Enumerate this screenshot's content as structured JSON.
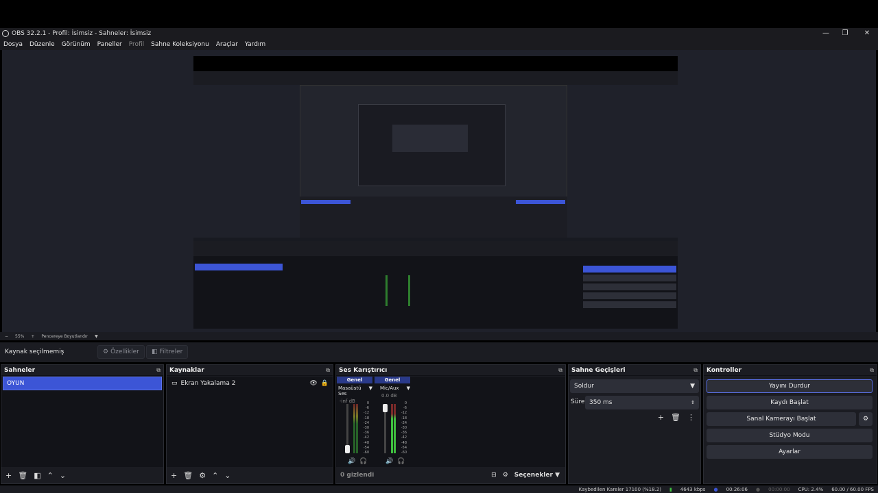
{
  "window": {
    "title": "OBS 32.2.1 - Profil: İsimsiz - Sahneler: İsimsiz"
  },
  "menu": [
    "Dosya",
    "Düzenle",
    "Görünüm",
    "Paneller",
    "Profil",
    "Sahne Koleksiyonu",
    "Araçlar",
    "Yardım"
  ],
  "zoom": {
    "minus": "−",
    "value": "55%",
    "plus": "+",
    "fit": "Pencereye Boyutlandır"
  },
  "source_bar": {
    "label": "Kaynak seçilmemiş",
    "properties": "Özellikler",
    "filters": "Filtreler"
  },
  "scenes": {
    "title": "Sahneler",
    "items": [
      "OYUN"
    ]
  },
  "sources": {
    "title": "Kaynaklar",
    "items": [
      "Ekran Yakalama 2"
    ]
  },
  "mixer": {
    "title": "Ses Karıştırıcı",
    "channels": [
      {
        "header": "Genel",
        "name": "Masaüstü Ses",
        "level": "-inf dB"
      },
      {
        "header": "Genel",
        "name": "Mic/Aux",
        "level": "0.0 dB"
      }
    ],
    "scale": [
      "0",
      "-6",
      "-12",
      "-18",
      "-24",
      "-30",
      "-36",
      "-42",
      "-48",
      "-54",
      "-60"
    ],
    "hidden": "0 gizlendi",
    "options": "Seçenekler"
  },
  "transitions": {
    "title": "Sahne Geçişleri",
    "type": "Soldur",
    "duration_label": "Süre",
    "duration": "350 ms"
  },
  "controls": {
    "title": "Kontroller",
    "stop_stream": "Yayını Durdur",
    "start_record": "Kaydı Başlat",
    "virtual_cam": "Sanal Kamerayı Başlat",
    "studio": "Stüdyo Modu",
    "settings": "Ayarlar"
  },
  "status": {
    "dropped": "Kaybedilen Kareler 17100 (%18.2)",
    "bitrate": "4643 kbps",
    "stream_time": "00:26:06",
    "rec_time": "00:00:00",
    "cpu": "CPU: 2.4%",
    "fps": "60.00 / 60.00 FPS"
  },
  "colors": {
    "accent": "#3c55d6",
    "bg": "#1b1c22",
    "panel": "#121318"
  }
}
